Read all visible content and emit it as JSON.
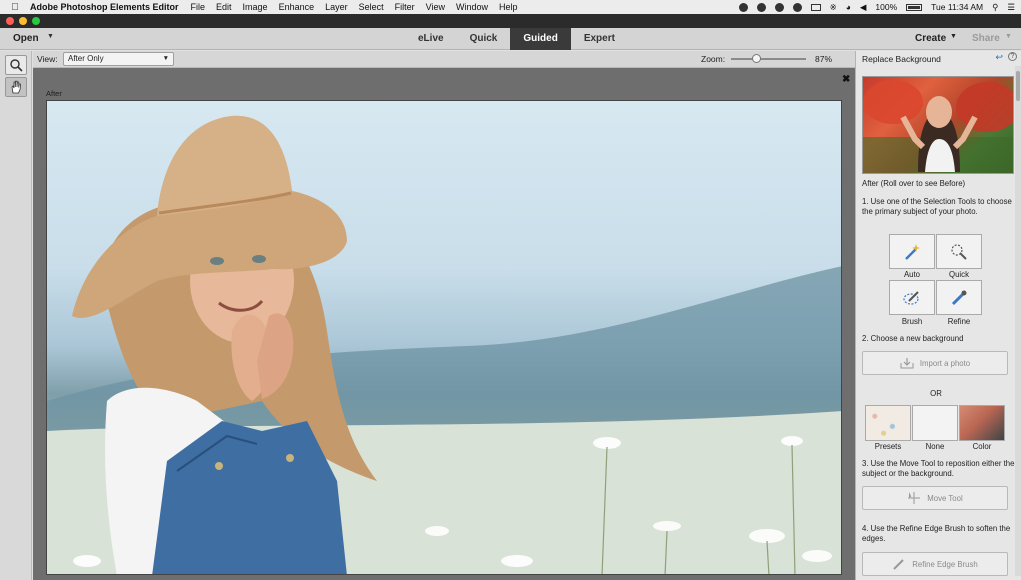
{
  "menubar": {
    "app_name": "Adobe Photoshop Elements Editor",
    "menus": [
      "File",
      "Edit",
      "Image",
      "Enhance",
      "Layer",
      "Select",
      "Filter",
      "View",
      "Window",
      "Help"
    ],
    "battery": "100%",
    "clock": "Tue 11:34 AM"
  },
  "appbar": {
    "open_label": "Open",
    "modes": [
      {
        "label": "eLive",
        "active": false
      },
      {
        "label": "Quick",
        "active": false
      },
      {
        "label": "Guided",
        "active": true
      },
      {
        "label": "Expert",
        "active": false
      }
    ],
    "create_label": "Create",
    "share_label": "Share"
  },
  "options": {
    "view_label": "View:",
    "view_value": "After Only",
    "zoom_label": "Zoom:",
    "zoom_value": "87%",
    "zoom_level": 0.87
  },
  "canvas": {
    "after_label": "After"
  },
  "panel": {
    "title": "Replace Background",
    "preview_caption": "After (Roll over to see Before)",
    "step1": "1. Use one of the Selection Tools to choose the primary subject of your photo.",
    "tools": [
      {
        "label": "Auto",
        "icon": "magic-wand-icon"
      },
      {
        "label": "Quick",
        "icon": "quick-selection-icon"
      },
      {
        "label": "Brush",
        "icon": "selection-brush-icon"
      },
      {
        "label": "Refine",
        "icon": "refine-selection-icon"
      }
    ],
    "step2": "2. Choose a new background",
    "import_label": "Import a photo",
    "or_label": "OR",
    "backgrounds": [
      {
        "label": "Presets"
      },
      {
        "label": "None"
      },
      {
        "label": "Color"
      }
    ],
    "step3": "3. Use the Move Tool to reposition either the subject or the background.",
    "move_tool_label": "Move Tool",
    "step4": "4. Use the Refine Edge Brush to soften the edges.",
    "refine_edge_label": "Refine Edge Brush"
  },
  "colors": {
    "active_tab": "#3a3a3a",
    "accent_blue": "#2a6fb8"
  }
}
